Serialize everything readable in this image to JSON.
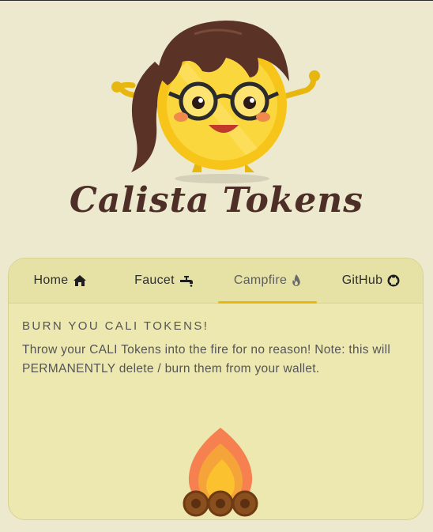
{
  "brand": {
    "logo_text": "Calista Tokens"
  },
  "nav": {
    "tabs": [
      {
        "label": "Home",
        "icon": "home-icon",
        "active": false
      },
      {
        "label": "Faucet",
        "icon": "faucet-icon",
        "active": false
      },
      {
        "label": "Campfire",
        "icon": "fire-icon",
        "active": true
      },
      {
        "label": "GitHub",
        "icon": "github-icon",
        "active": false
      }
    ]
  },
  "campfire": {
    "heading": "BURN YOU CALI TOKENS!",
    "description": "Throw your CALI Tokens into the fire for no reason! Note: this will PERMANENTLY delete / burn them from your wallet."
  },
  "colors": {
    "background": "#ece9cf",
    "card": "#ece8b0",
    "tab_indicator": "#e8b70f",
    "logo_text": "#4e2f27"
  }
}
